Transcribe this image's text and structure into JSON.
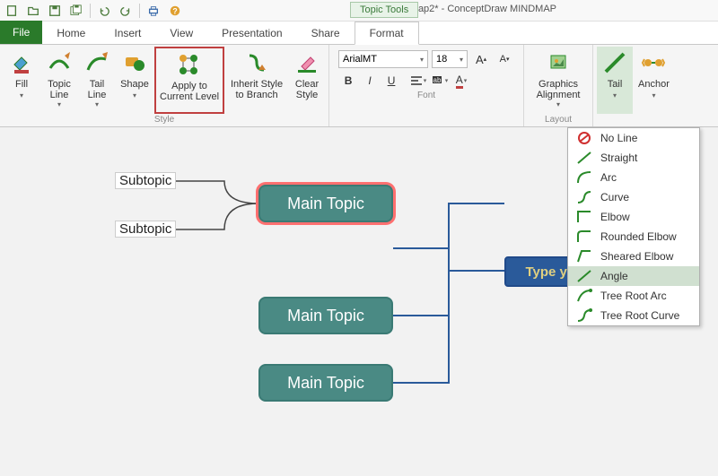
{
  "app": {
    "title": "CDMap2* - ConceptDraw MINDMAP"
  },
  "tabs": {
    "file": "File",
    "items": [
      "Home",
      "Insert",
      "View",
      "Presentation",
      "Share",
      "Format"
    ],
    "context_header": "Topic Tools"
  },
  "ribbon": {
    "fill": "Fill",
    "topic_line": "Topic\nLine",
    "tail_line": "Tail\nLine",
    "shape": "Shape",
    "apply_current": "Apply to\nCurrent Level",
    "inherit": "Inherit Style\nto Branch",
    "clear": "Clear\nStyle",
    "style_group": "Style",
    "font_group": "Font",
    "font_name": "ArialMT",
    "font_size": "18",
    "bold": "B",
    "italic": "I",
    "underline": "U",
    "layout_group": "Layout",
    "graphics_align": "Graphics\nAlignment",
    "tail": "Tail",
    "anchor": "Anchor"
  },
  "tail_menu": {
    "items": [
      {
        "name": "no-line",
        "label": "No Line"
      },
      {
        "name": "straight",
        "label": "Straight"
      },
      {
        "name": "arc",
        "label": "Arc"
      },
      {
        "name": "curve",
        "label": "Curve"
      },
      {
        "name": "elbow",
        "label": "Elbow"
      },
      {
        "name": "rounded-elbow",
        "label": "Rounded Elbow"
      },
      {
        "name": "sheared-elbow",
        "label": "Sheared Elbow"
      },
      {
        "name": "angle",
        "label": "Angle",
        "selected": true
      },
      {
        "name": "tree-root-arc",
        "label": "Tree Root Arc"
      },
      {
        "name": "tree-root-curve",
        "label": "Tree Root Curve"
      }
    ]
  },
  "map": {
    "subtopic": "Subtopic",
    "main_topic": "Main Topic",
    "main_idea": "Type your Main Idea"
  }
}
